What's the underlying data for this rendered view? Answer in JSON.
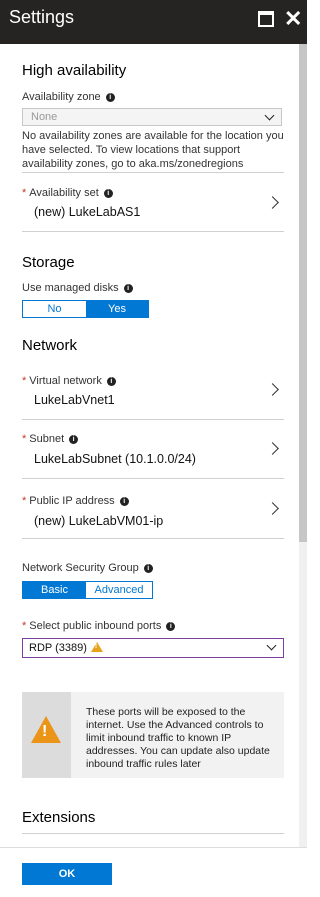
{
  "window": {
    "title": "Settings"
  },
  "high_availability": {
    "title": "High availability",
    "zone_label": "Availability zone",
    "zone_value": "None",
    "zone_note": "No availability zones are available for the location you have selected. To view locations that support availability zones, go to aka.ms/zonedregions",
    "set_label": "Availability set",
    "set_value": "(new) LukeLabAS1"
  },
  "storage": {
    "title": "Storage",
    "managed_label": "Use managed disks",
    "options": [
      "No",
      "Yes"
    ],
    "selected": "Yes"
  },
  "network": {
    "title": "Network",
    "vnet_label": "Virtual network",
    "vnet_value": "LukeLabVnet1",
    "subnet_label": "Subnet",
    "subnet_value": "LukeLabSubnet (10.1.0.0/24)",
    "pip_label": "Public IP address",
    "pip_value": "(new) LukeLabVM01-ip",
    "nsg_label": "Network Security Group",
    "nsg_options": [
      "Basic",
      "Advanced"
    ],
    "nsg_selected": "Basic",
    "ports_label": "Select public inbound ports",
    "ports_value": "RDP (3389)",
    "warning": "These ports will be exposed to the internet. Use the Advanced controls to limit inbound traffic to known IP addresses. You can update also update inbound traffic rules later"
  },
  "extensions": {
    "title": "Extensions"
  },
  "footer": {
    "ok_label": "OK"
  }
}
